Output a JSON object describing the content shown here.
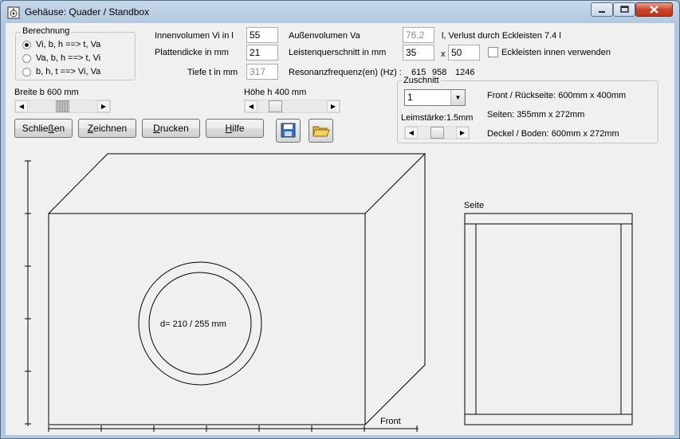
{
  "window": {
    "title": "Gehäuse: Quader / Standbox"
  },
  "berechnung": {
    "legend": "Berechnung",
    "options": [
      {
        "label": "Vi, b, h ==>  t, Va",
        "selected": true
      },
      {
        "label": "Va, b, h ==> t, Vi",
        "selected": false
      },
      {
        "label": "b, h, t ==> Vi, Va",
        "selected": false
      }
    ]
  },
  "fields": {
    "innenvolumen": {
      "label": "Innenvolumen Vi in l",
      "value": "55"
    },
    "plattendicke": {
      "label": "Plattendicke in mm",
      "value": "21"
    },
    "tiefe": {
      "label": "Tiefe t in mm",
      "value": "317"
    },
    "aussenvolumen": {
      "label": "Außenvolumen Va",
      "value": "76,2",
      "suffix": "l,  Verlust durch Eckleisten 7.4 l"
    },
    "leistenquerschnitt": {
      "label": "Leistenquerschnitt in mm",
      "value_a": "35",
      "separator": "x",
      "value_b": "50"
    },
    "eckleisten": {
      "label": "Eckleisten innen verwenden",
      "checked": false
    },
    "resonanz": {
      "label": "Resonanzfrequenz(en) (Hz) :",
      "values": [
        "615",
        "958",
        "1246"
      ]
    }
  },
  "sliders": {
    "breite": {
      "label": "Breite b 600 mm",
      "position": 0.5
    },
    "hoehe": {
      "label": "Höhe h 400 mm",
      "position": 0.2
    }
  },
  "zuschnitt": {
    "legend": "Zuschnitt",
    "combo_value": "1",
    "leimstaerke_label": "Leimstärke:1.5mm",
    "leim_position": 0.5,
    "lines": [
      "Front / Rückseite: 600mm x 400mm",
      "Seiten: 355mm x 272mm",
      "Deckel / Boden: 600mm x 272mm"
    ]
  },
  "buttons": {
    "schliessen": {
      "pre": "Schlie",
      "u": "ß",
      "post": "en"
    },
    "zeichnen": {
      "pre": "",
      "u": "Z",
      "post": "eichnen"
    },
    "drucken": {
      "pre": "",
      "u": "D",
      "post": "rucken"
    },
    "hilfe": {
      "pre": "",
      "u": "H",
      "post": "ilfe"
    }
  },
  "drawing": {
    "driver_label": "d= 210 / 255 mm",
    "front_label": "Front",
    "side_label": "Seite"
  },
  "icons": {
    "save": "floppy-disk-icon",
    "open": "open-folder-icon",
    "app": "speaker-app-icon"
  },
  "colors": {
    "titlebar": "#b3c8de",
    "client": "#f0f0f0",
    "close": "#c9452d"
  }
}
